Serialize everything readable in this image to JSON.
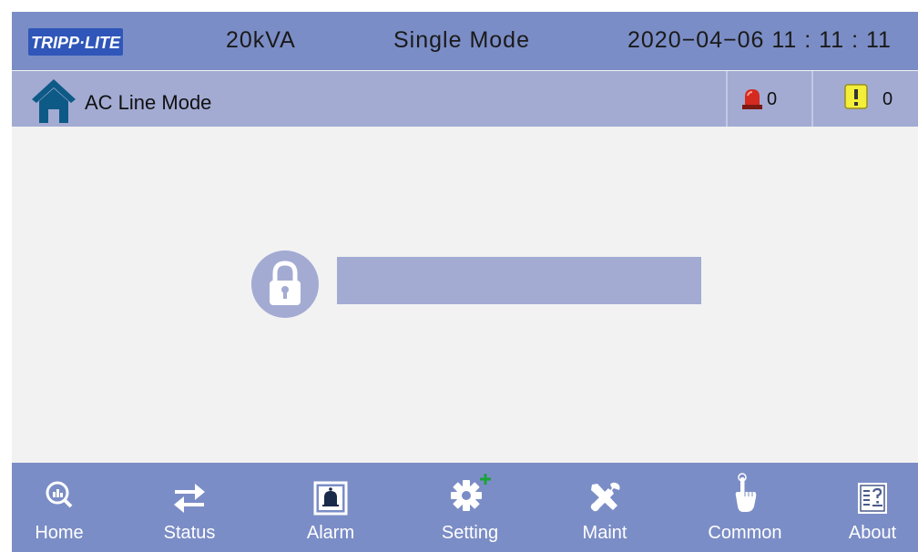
{
  "header": {
    "logo_text": "TRIPP·LITE",
    "capacity": "20kVA",
    "mode": "Single  Mode",
    "datetime": "2020−04−06  11 : 11 : 11"
  },
  "status_bar": {
    "mode_label": "AC Line Mode",
    "alarm_count": "0",
    "warning_count": "0"
  },
  "login": {
    "password_value": "",
    "password_placeholder": ""
  },
  "nav": {
    "home": "Home",
    "status": "Status",
    "alarm": "Alarm",
    "setting": "Setting",
    "maint": "Maint",
    "common": "Common",
    "about": "About"
  },
  "colors": {
    "header_bg": "#7b8dc6",
    "subbar_bg": "#a3abd3",
    "content_bg": "#f2f2f2",
    "home_icon": "#0e5a86",
    "alarm_red": "#d42a1f",
    "warning_yellow": "#f3ee3a"
  },
  "icons": [
    "home-icon",
    "alarm-light-icon",
    "warning-icon",
    "lock-icon",
    "magnifier-chart-icon",
    "swap-arrows-icon",
    "bell-icon",
    "gear-plus-icon",
    "tools-icon",
    "finger-touch-icon",
    "document-icon"
  ]
}
